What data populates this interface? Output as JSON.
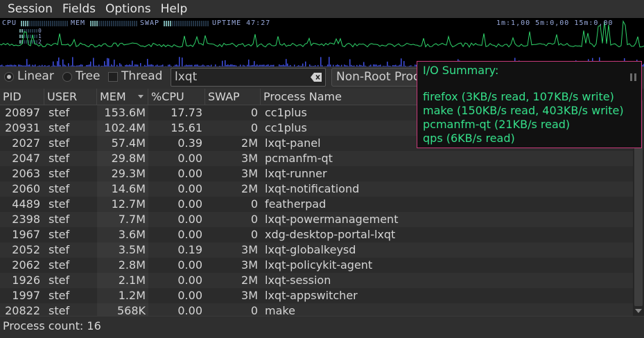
{
  "menubar": [
    "Session",
    "Fields",
    "Options",
    "Help"
  ],
  "graph": {
    "cpu_label": "CPU",
    "mem_label": "MEM",
    "swap_label": "SWAP",
    "uptime": "UPTIME 47:27",
    "load": "1m:1,00 5m:0,00 15m:0,00",
    "cpu_rows": [
      "0",
      "1",
      "2",
      "3"
    ],
    "line_color": "#2fd46a",
    "io_color": "#4050e0"
  },
  "toolbar": {
    "linear": "Linear",
    "tree": "Tree",
    "thread": "Thread",
    "search_value": "lxqt",
    "filter": "Non-Root Processes"
  },
  "columns": [
    "PID",
    "USER",
    "MEM",
    "%CPU",
    "SWAP",
    "Process Name"
  ],
  "rows": [
    [
      "20897",
      "stef",
      "153.6M",
      "17.73",
      "0",
      "cc1plus"
    ],
    [
      "20931",
      "stef",
      "102.4M",
      "15.61",
      "0",
      "cc1plus"
    ],
    [
      "2027",
      "stef",
      "57.4M",
      "0.39",
      "2M",
      "lxqt-panel"
    ],
    [
      "2047",
      "stef",
      "29.8M",
      "0.00",
      "3M",
      "pcmanfm-qt"
    ],
    [
      "2063",
      "stef",
      "29.3M",
      "0.00",
      "3M",
      "lxqt-runner"
    ],
    [
      "2060",
      "stef",
      "14.6M",
      "0.00",
      "2M",
      "lxqt-notificationd"
    ],
    [
      "4489",
      "stef",
      "12.7M",
      "0.00",
      "0",
      "featherpad"
    ],
    [
      "2398",
      "stef",
      "7.7M",
      "0.00",
      "0",
      "lxqt-powermanagement"
    ],
    [
      "1967",
      "stef",
      "3.6M",
      "0.00",
      "0",
      "xdg-desktop-portal-lxqt"
    ],
    [
      "2052",
      "stef",
      "3.5M",
      "0.19",
      "3M",
      "lxqt-globalkeysd"
    ],
    [
      "2062",
      "stef",
      "2.8M",
      "0.00",
      "3M",
      "lxqt-policykit-agent"
    ],
    [
      "1926",
      "stef",
      "2.1M",
      "0.00",
      "2M",
      "lxqt-session"
    ],
    [
      "1997",
      "stef",
      "1.2M",
      "0.00",
      "3M",
      "lxqt-appswitcher"
    ],
    [
      "20822",
      "stef",
      "568K",
      "0.00",
      "0",
      "make"
    ]
  ],
  "status": "Process count: 16",
  "io_summary": {
    "title": "I/O Summary:",
    "lines": [
      "firefox (3KB/s read, 107KB/s write)",
      "make (150KB/s read, 403KB/s write)",
      "pcmanfm-qt (21KB/s read)",
      "qps (6KB/s read)"
    ]
  }
}
